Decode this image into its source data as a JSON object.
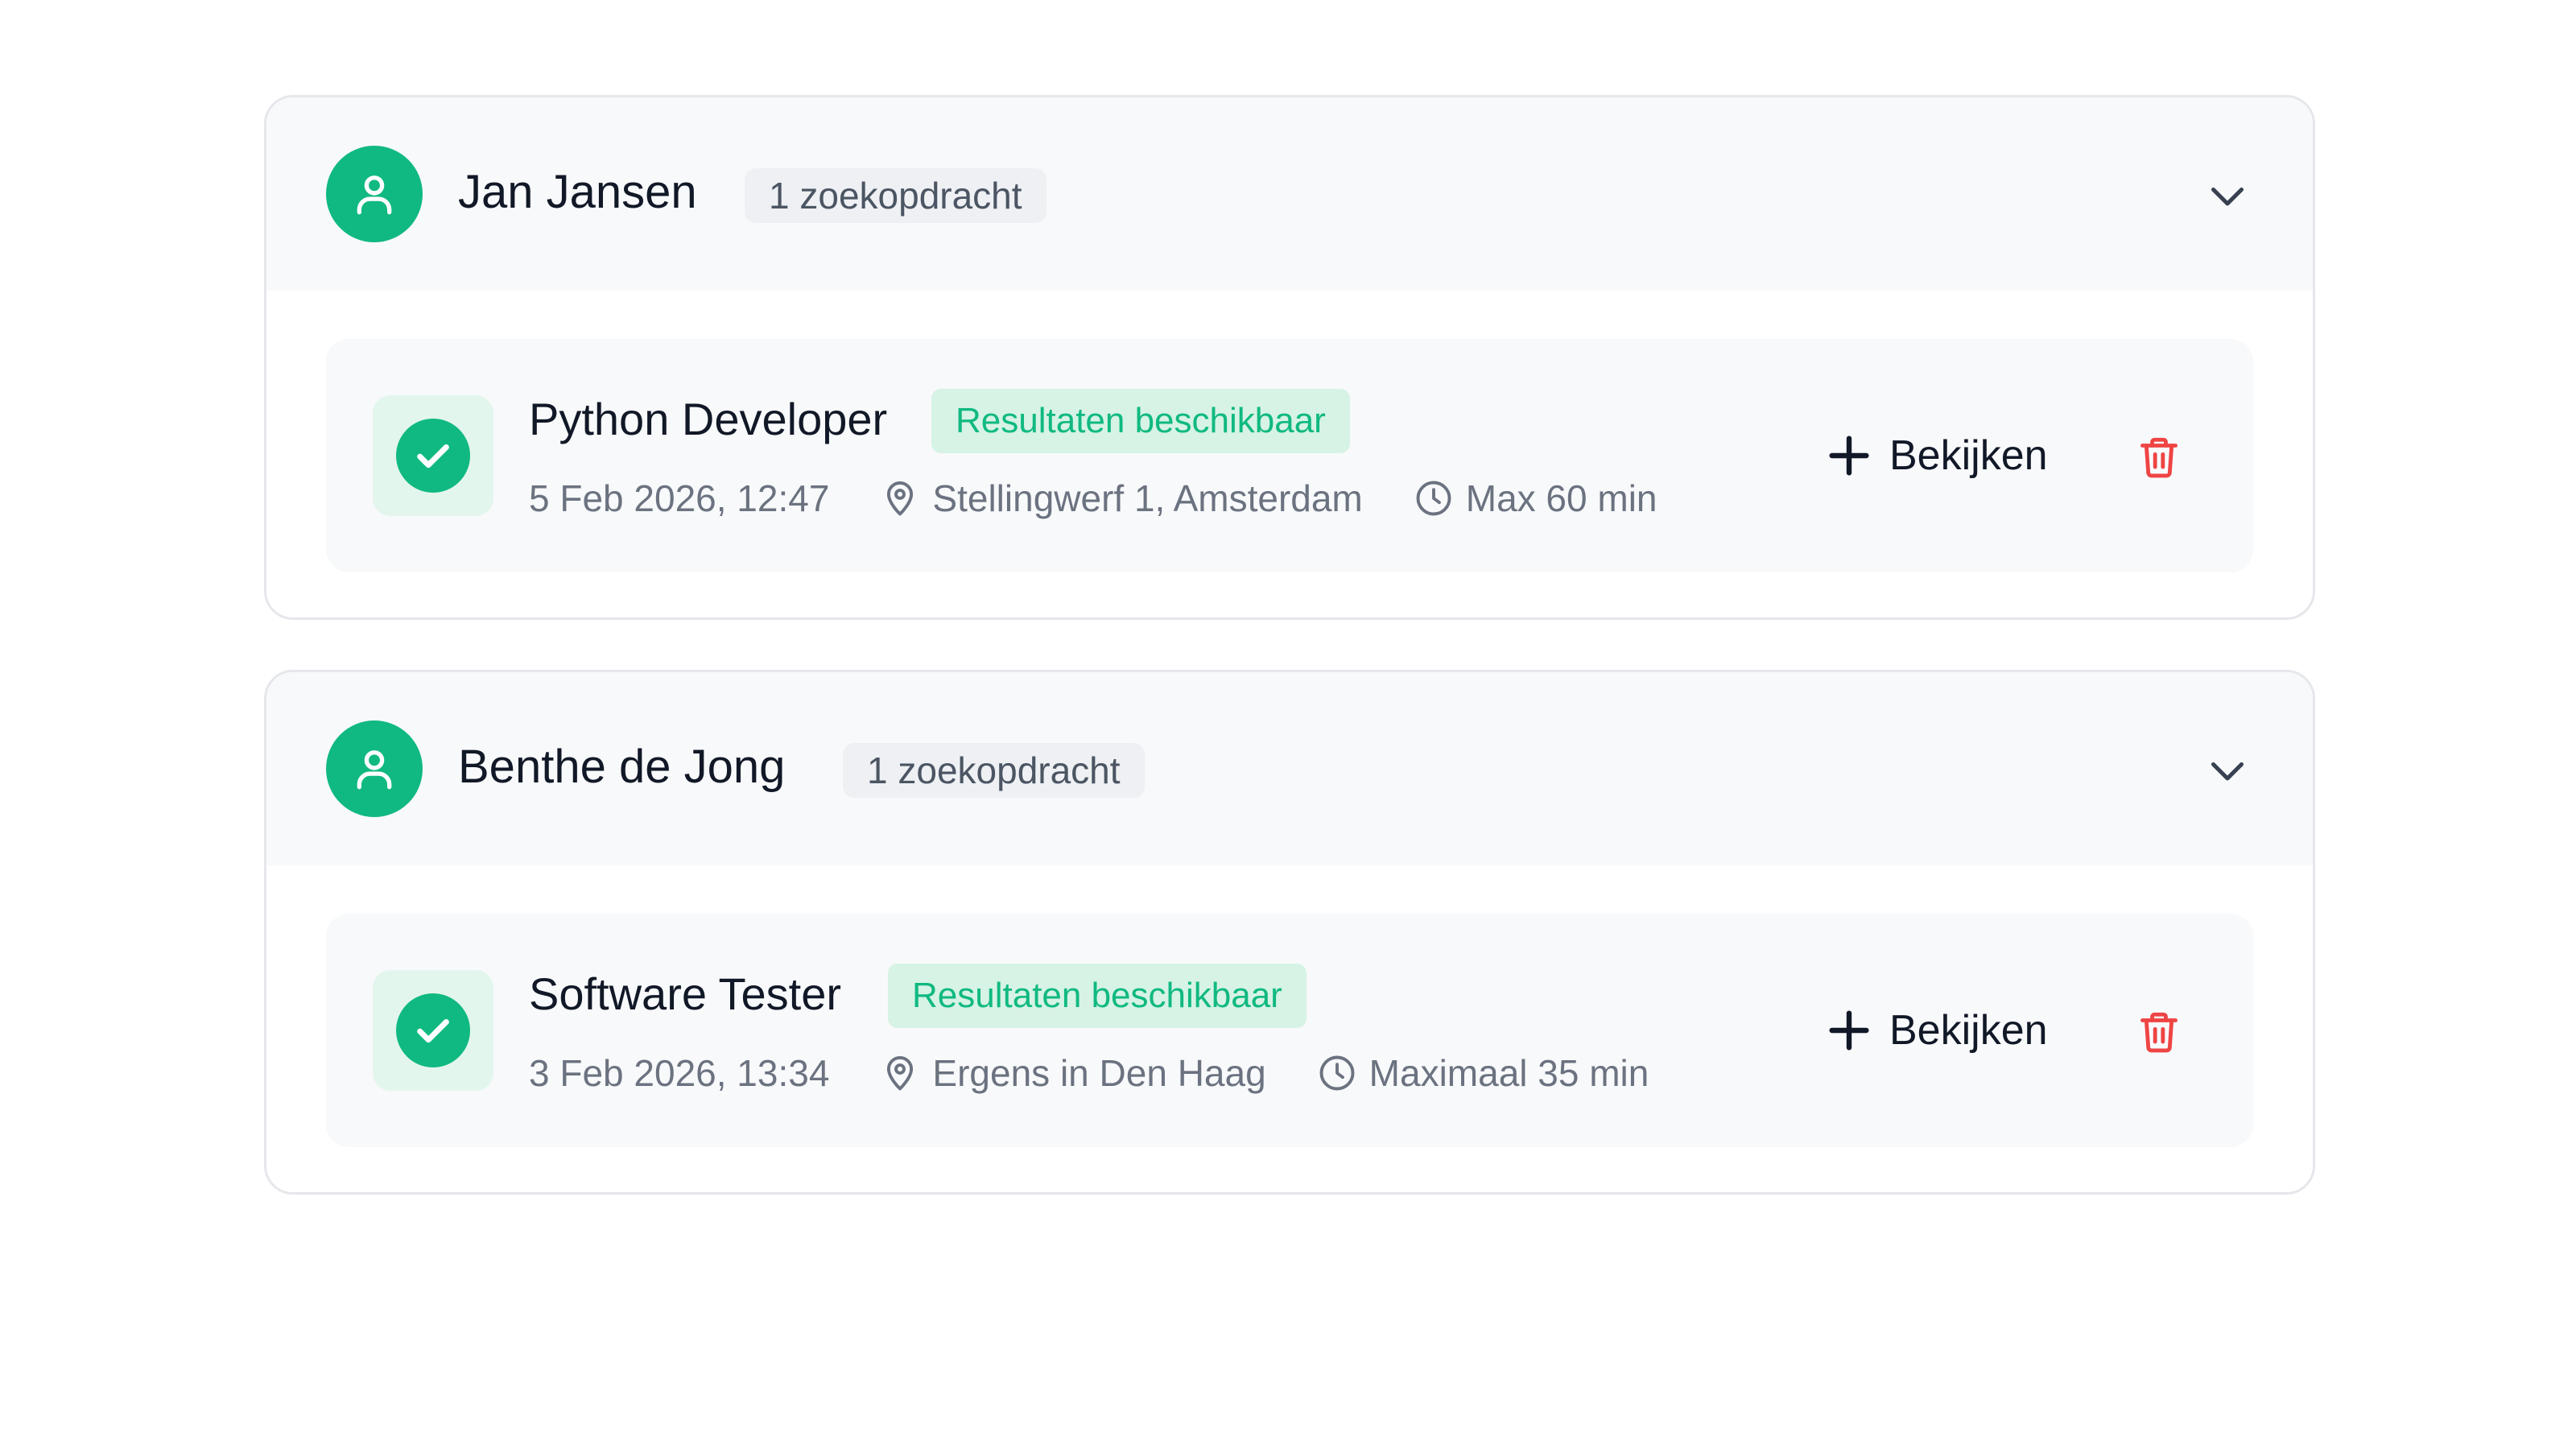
{
  "colors": {
    "accent": "#10b981",
    "accent_soft": "#d6f3e5",
    "danger": "#ef4444",
    "text": "#111827",
    "muted": "#6b7280",
    "card_header_bg": "#f8f9fa",
    "border": "#e5e7eb"
  },
  "profiles": [
    {
      "name": "Jan Jansen",
      "count_label": "1 zoekopdracht",
      "avatar_icon": "user-icon",
      "expand_icon": "chevron-down-icon",
      "searches": [
        {
          "title": "Python Developer",
          "status_label": "Resultaten beschikbaar",
          "status_icon": "check-circle-icon",
          "date": "5 Feb 2026, 12:47",
          "location": "Stellingwerf 1, Amsterdam",
          "location_icon": "map-pin-icon",
          "travel": "Max 60 min",
          "travel_icon": "clock-icon",
          "view_label": "Bekijken",
          "view_icon": "plus-icon",
          "delete_icon": "trash-icon"
        }
      ]
    },
    {
      "name": "Benthe de Jong",
      "count_label": "1 zoekopdracht",
      "avatar_icon": "user-icon",
      "expand_icon": "chevron-down-icon",
      "searches": [
        {
          "title": "Software Tester",
          "status_label": "Resultaten beschikbaar",
          "status_icon": "check-circle-icon",
          "date": "3 Feb 2026, 13:34",
          "location": "Ergens in Den Haag",
          "location_icon": "map-pin-icon",
          "travel": "Maximaal 35 min",
          "travel_icon": "clock-icon",
          "view_label": "Bekijken",
          "view_icon": "plus-icon",
          "delete_icon": "trash-icon"
        }
      ]
    }
  ]
}
